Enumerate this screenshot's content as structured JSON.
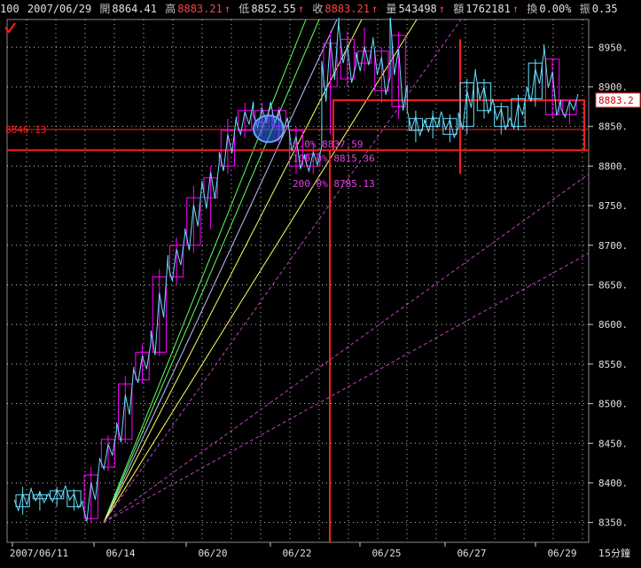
{
  "info_bar": {
    "symbol": "100",
    "date": "2007/06/29",
    "open_label": "開",
    "open": "8864.41",
    "high_label": "高",
    "high": "8883.21",
    "low_label": "低",
    "low": "8852.55",
    "close_label": "收",
    "close": "8883.21",
    "volume_label": "量",
    "volume": "543498",
    "amount_label": "額",
    "amount": "1762181",
    "turnover_label": "換",
    "turnover": "0.00%",
    "amplitude_label": "振",
    "amplitude": "0.35"
  },
  "last_price_tag": "8883.2",
  "level_tag": "8846.13",
  "interval_label": "15分鐘",
  "annotations": [
    {
      "text": "0.0% 8837.59",
      "price": 8828
    },
    {
      "text": "100.0% 8815.36",
      "price": 8810
    },
    {
      "text": "200.0% 8785.13",
      "price": 8778
    }
  ],
  "colors": {
    "background": "#000000",
    "grid": "#ffffff",
    "candle": "#ff00ff",
    "price_line": "#66e0ff",
    "red_box": "#ff2020",
    "fan_green": "#60ff60",
    "fan_yellow": "#ffff60",
    "fan_magenta": "#c040c0",
    "circle": "#3070ff"
  },
  "chart_data": {
    "type": "line",
    "title": "",
    "interval": "15分鐘",
    "x_ticks": [
      "2007/06/11",
      "06/14",
      "06/20",
      "06/22",
      "06/25",
      "06/27",
      "06/29"
    ],
    "y_ticks": [
      8350,
      8400,
      8450,
      8500,
      8550,
      8600,
      8650,
      8700,
      8750,
      8800,
      8850,
      8900,
      8950
    ],
    "ylim": [
      8325,
      8985
    ],
    "grid": true,
    "levels": [
      {
        "name": "8846.13",
        "value": 8846.13
      },
      {
        "name": "0.0%",
        "value": 8837.59
      },
      {
        "name": "100.0%",
        "value": 8815.36
      },
      {
        "name": "200.0%",
        "value": 8785.13
      }
    ],
    "last_price": 8883.21,
    "candles": [
      {
        "open": 8370,
        "close": 8385,
        "high": 8395,
        "low": 8360
      },
      {
        "open": 8385,
        "close": 8380,
        "high": 8390,
        "low": 8365
      },
      {
        "open": 8380,
        "close": 8390,
        "high": 8395,
        "low": 8370
      },
      {
        "open": 8390,
        "close": 8370,
        "high": 8392,
        "low": 8365
      },
      {
        "open": 8355,
        "close": 8410,
        "high": 8420,
        "low": 8350
      },
      {
        "open": 8420,
        "close": 8455,
        "high": 8460,
        "low": 8415
      },
      {
        "open": 8455,
        "close": 8525,
        "high": 8535,
        "low": 8450
      },
      {
        "open": 8530,
        "close": 8565,
        "high": 8575,
        "low": 8525
      },
      {
        "open": 8565,
        "close": 8660,
        "high": 8670,
        "low": 8560
      },
      {
        "open": 8660,
        "close": 8700,
        "high": 8710,
        "low": 8650
      },
      {
        "open": 8700,
        "close": 8760,
        "high": 8775,
        "low": 8690
      },
      {
        "open": 8760,
        "close": 8785,
        "high": 8800,
        "low": 8720
      },
      {
        "open": 8800,
        "close": 8845,
        "high": 8860,
        "low": 8790
      },
      {
        "open": 8845,
        "close": 8870,
        "high": 8880,
        "low": 8835
      },
      {
        "open": 8855,
        "close": 8870,
        "high": 8880,
        "low": 8840
      },
      {
        "open": 8870,
        "close": 8850,
        "high": 8875,
        "low": 8830
      },
      {
        "open": 8845,
        "close": 8800,
        "high": 8850,
        "low": 8790
      },
      {
        "open": 8800,
        "close": 8815,
        "high": 8830,
        "low": 8790
      },
      {
        "open": 8900,
        "close": 8955,
        "high": 8970,
        "low": 8840
      },
      {
        "open": 8960,
        "close": 8910,
        "high": 8970,
        "low": 8900
      },
      {
        "open": 8930,
        "close": 8945,
        "high": 8975,
        "low": 8920
      },
      {
        "open": 8945,
        "close": 8895,
        "high": 8950,
        "low": 8880
      },
      {
        "open": 8965,
        "close": 8875,
        "high": 8970,
        "low": 8860
      },
      {
        "open": 8860,
        "close": 8845,
        "high": 8870,
        "low": 8830
      },
      {
        "open": 8850,
        "close": 8860,
        "high": 8870,
        "low": 8835
      },
      {
        "open": 8860,
        "close": 8840,
        "high": 8865,
        "low": 8830
      },
      {
        "open": 8850,
        "close": 8905,
        "high": 8910,
        "low": 8840
      },
      {
        "open": 8905,
        "close": 8870,
        "high": 8910,
        "low": 8860
      },
      {
        "open": 8875,
        "close": 8850,
        "high": 8880,
        "low": 8840
      },
      {
        "open": 8850,
        "close": 8885,
        "high": 8890,
        "low": 8845
      },
      {
        "open": 8885,
        "close": 8930,
        "high": 8935,
        "low": 8875
      },
      {
        "open": 8935,
        "close": 8865,
        "high": 8935,
        "low": 8860
      },
      {
        "open": 8865,
        "close": 8883.21,
        "high": 8883.21,
        "low": 8852.55
      }
    ]
  }
}
